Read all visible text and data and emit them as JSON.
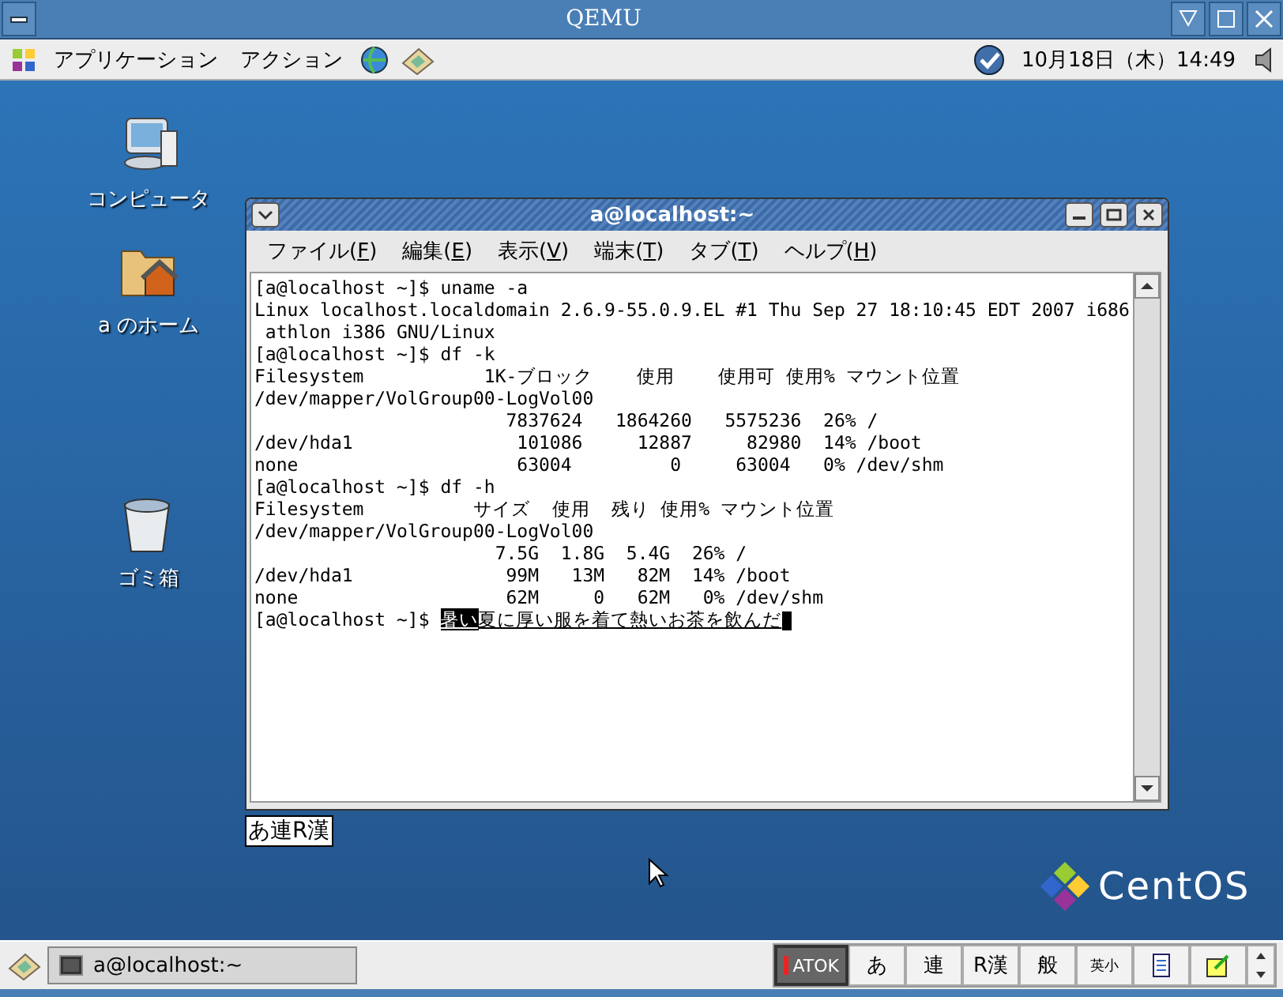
{
  "outer_window": {
    "title": "QEMU"
  },
  "top_panel": {
    "menus": [
      "アプリケーション",
      "アクション"
    ],
    "clock": "10月18日（木）14:49"
  },
  "desktop_icons": [
    {
      "label": "コンピュータ",
      "kind": "computer"
    },
    {
      "label": "a のホーム",
      "kind": "home"
    },
    {
      "label": "ゴミ箱",
      "kind": "trash"
    }
  ],
  "terminal": {
    "title": "a@localhost:~",
    "menu": [
      {
        "before": "ファイル(",
        "mnemonic": "F",
        "after": ")"
      },
      {
        "before": "編集(",
        "mnemonic": "E",
        "after": ")"
      },
      {
        "before": "表示(",
        "mnemonic": "V",
        "after": ")"
      },
      {
        "before": "端末(",
        "mnemonic": "T",
        "after": ")"
      },
      {
        "before": "タブ(",
        "mnemonic": "T",
        "after": ")"
      },
      {
        "before": "ヘルプ(",
        "mnemonic": "H",
        "after": ")"
      }
    ],
    "lines": [
      "[a@localhost ~]$ uname -a",
      "Linux localhost.localdomain 2.6.9-55.0.9.EL #1 Thu Sep 27 18:10:45 EDT 2007 i686",
      " athlon i386 GNU/Linux",
      "[a@localhost ~]$ df -k",
      "Filesystem           1K-ブロック    使用    使用可 使用% マウント位置",
      "/dev/mapper/VolGroup00-LogVol00",
      "                       7837624   1864260   5575236  26% /",
      "/dev/hda1               101086     12887     82980  14% /boot",
      "none                    63004         0     63004   0% /dev/shm",
      "[a@localhost ~]$ df -h",
      "Filesystem          サイズ  使用  残り 使用% マウント位置",
      "/dev/mapper/VolGroup00-LogVol00",
      "                      7.5G  1.8G  5.4G  26% /",
      "/dev/hda1              99M   13M   82M  14% /boot",
      "none                   62M     0   62M   0% /dev/shm"
    ],
    "input_line": {
      "prompt": "[a@localhost ~]$ ",
      "converted": "暑い",
      "pending": "夏に厚い服を着て熱いお茶を飲んだ"
    }
  },
  "ime_indicator": "あ連R漢",
  "logo": "CentOS",
  "bottom_panel": {
    "tasks": [
      {
        "label": "a@localhost:~",
        "selected": false
      }
    ],
    "ime_buttons": [
      "ATOK",
      "あ",
      "連",
      "R漢",
      "般",
      "英小"
    ]
  }
}
